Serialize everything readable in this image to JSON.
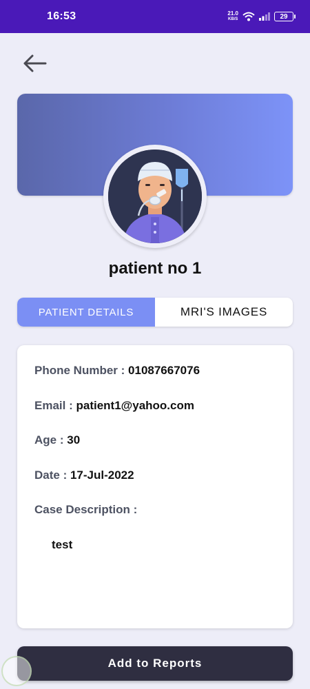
{
  "status_bar": {
    "time": "16:53",
    "net_speed_value": "21.0",
    "net_speed_unit": "KB/S",
    "battery": "29"
  },
  "header": {
    "back_icon": "arrow-left-icon"
  },
  "patient": {
    "name": "patient no 1"
  },
  "tabs": [
    {
      "label": "PATIENT DETAILS",
      "active": true
    },
    {
      "label": "MRI'S IMAGES",
      "active": false
    }
  ],
  "details": {
    "phone_label": "Phone Number :",
    "phone_value": "01087667076",
    "email_label": "Email :",
    "email_value": "patient1@yahoo.com",
    "age_label": "Age :",
    "age_value": "30",
    "date_label": "Date :",
    "date_value": "17-Jul-2022",
    "case_label": "Case Description :",
    "case_value": "test"
  },
  "actions": {
    "add_reports_label": "Add to Reports"
  },
  "colors": {
    "status_bar": "#4a19b8",
    "tab_active": "#7b8ff4",
    "button_dark": "#2f2e41",
    "label_gray": "#4d5262"
  }
}
